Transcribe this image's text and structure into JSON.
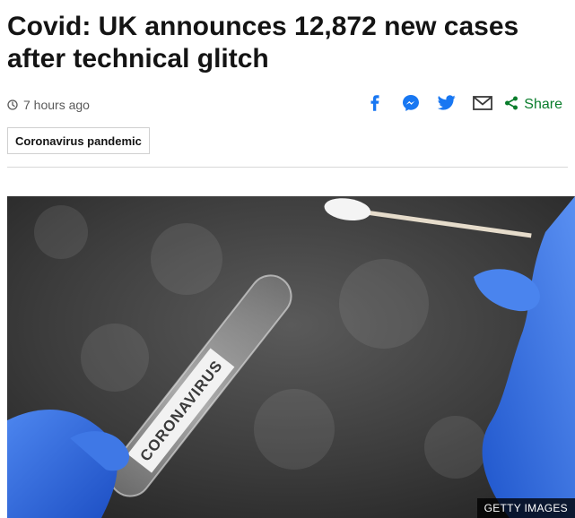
{
  "article": {
    "headline": "Covid: UK announces 12,872 new cases after technical glitch",
    "timestamp": "7 hours ago",
    "topic_tag": "Coronavirus pandemic"
  },
  "share_tools": {
    "share_label": "Share",
    "icons": [
      "facebook-icon",
      "messenger-icon",
      "twitter-icon",
      "email-icon",
      "share-icon"
    ]
  },
  "hero_image": {
    "tube_label": "CORONAVIRUS",
    "credit": "GETTY IMAGES"
  },
  "colors": {
    "headline": "#141414",
    "meta_text": "#5a5a5a",
    "social_blue": "#1877f2",
    "share_green": "#0a7d2c",
    "glove_blue": "#2f6fe8"
  }
}
